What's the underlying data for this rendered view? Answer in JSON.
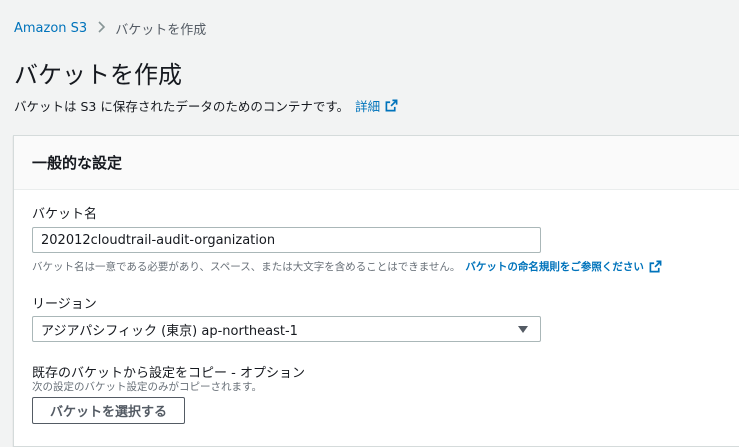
{
  "breadcrumb": {
    "root": "Amazon S3",
    "current": "バケットを作成"
  },
  "page": {
    "title": "バケットを作成",
    "description": "バケットは S3 に保存されたデータのためのコンテナです。",
    "info_link": "詳細"
  },
  "general": {
    "heading": "一般的な設定",
    "bucket_name_label": "バケット名",
    "bucket_name_value": "202012cloudtrail-audit-organization",
    "bucket_name_hint": "バケット名は一意である必要があり、スペース、または大文字を含めることはできません。",
    "naming_rules_link": "バケットの命名規則をご参照ください",
    "region_label": "リージョン",
    "region_value": "アジアパシフィック (東京) ap-northeast-1",
    "copy_label": "既存のバケットから設定をコピー - オプション",
    "copy_hint": "次の設定のバケット設定のみがコピーされます。",
    "choose_bucket_button": "バケットを選択する"
  },
  "colors": {
    "link": "#0073bb",
    "background": "#f2f3f3",
    "text": "#16191f"
  },
  "icons": [
    "chevron-right-icon",
    "external-link-icon",
    "caret-down-icon"
  ]
}
